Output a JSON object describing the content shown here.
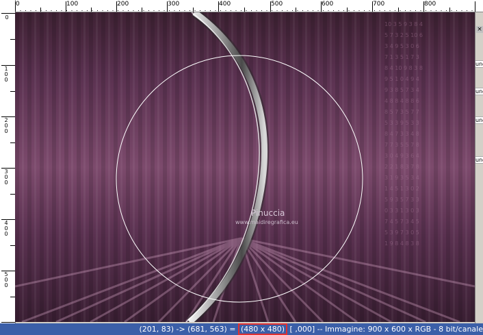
{
  "ruler": {
    "h_labels": [
      "0",
      "100",
      "200",
      "300",
      "400",
      "500",
      "600",
      "700",
      "800"
    ],
    "v_labels": [
      "0",
      "100",
      "200",
      "300",
      "400",
      "500"
    ]
  },
  "watermark": {
    "title": "Pinuccia",
    "site": "www.maidiregrafica.eu"
  },
  "right_panel": {
    "items": [
      "unc",
      "unc",
      "unc",
      "unc"
    ]
  },
  "status": {
    "coords": "(201, 83) -> (681, 563) = ",
    "size": "(480 x 480)",
    "rest": " [ ,000] -- Immagine:  900 x 600 x RGB - 8 bit/canale"
  },
  "colors": {
    "canvas_base": "#5e3552",
    "canvas_band": "#7e4a6e",
    "status_bg": "#3b5fa8",
    "highlight": "#e03030"
  }
}
